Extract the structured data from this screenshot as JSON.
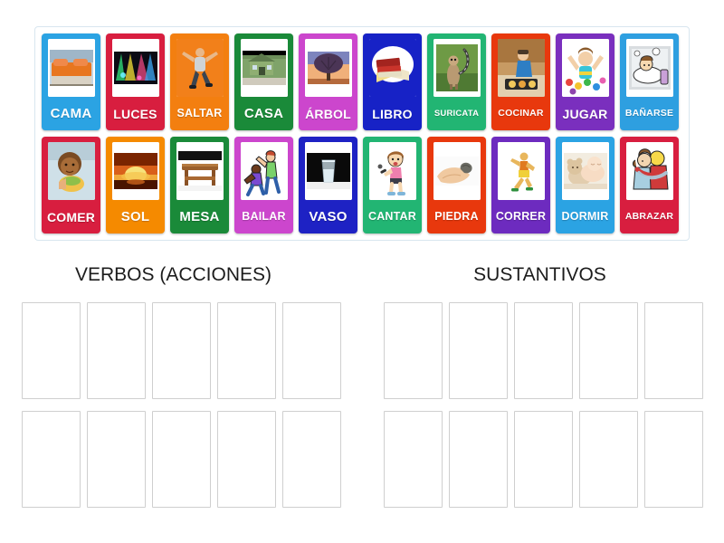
{
  "activity": {
    "type": "group-sort",
    "tray_rows": 2,
    "cards_per_row": 10
  },
  "tray": {
    "row1": [
      {
        "label": "CAMA",
        "color": "#2ba3e3",
        "image": "bed-photo",
        "category": "sustantivo"
      },
      {
        "label": "LUCES",
        "color": "#d81e3f",
        "image": "stage-lights-photo",
        "category": "sustantivo"
      },
      {
        "label": "SALTAR",
        "color": "#f37f10",
        "image": "jumping-man-photo",
        "category": "verbo"
      },
      {
        "label": "CASA",
        "color": "#1a8a39",
        "image": "house-photo",
        "category": "sustantivo"
      },
      {
        "label": "ÁRBOL",
        "color": "#cc46cd",
        "image": "tree-photo",
        "category": "sustantivo"
      },
      {
        "label": "LIBRO",
        "color": "#1722c6",
        "image": "books-illustration",
        "category": "sustantivo"
      },
      {
        "label": "SURICATA",
        "color": "#22b573",
        "image": "meerkat-photo",
        "category": "sustantivo"
      },
      {
        "label": "COCINAR",
        "color": "#e8380d",
        "image": "cooking-photo",
        "category": "verbo"
      },
      {
        "label": "JUGAR",
        "color": "#7a2fbe",
        "image": "child-playing-photo",
        "category": "verbo"
      },
      {
        "label": "BAÑARSE",
        "color": "#2e9fe0",
        "image": "bathing-illustration",
        "category": "verbo"
      }
    ],
    "row2": [
      {
        "label": "COMER",
        "color": "#d81e3f",
        "image": "child-eating-photo",
        "category": "verbo"
      },
      {
        "label": "SOL",
        "color": "#f58a00",
        "image": "sunset-photo",
        "category": "sustantivo"
      },
      {
        "label": "MESA",
        "color": "#1a8a39",
        "image": "table-photo",
        "category": "sustantivo"
      },
      {
        "label": "BAILAR",
        "color": "#cc46cd",
        "image": "dancing-illustration",
        "category": "verbo"
      },
      {
        "label": "VASO",
        "color": "#1e22c4",
        "image": "glass-photo",
        "category": "sustantivo"
      },
      {
        "label": "CANTAR",
        "color": "#22b573",
        "image": "singing-girl-illustration",
        "category": "verbo"
      },
      {
        "label": "PIEDRA",
        "color": "#e8380d",
        "image": "stone-in-hand-photo",
        "category": "sustantivo"
      },
      {
        "label": "CORRER",
        "color": "#6d2bbf",
        "image": "running-illustration",
        "category": "verbo"
      },
      {
        "label": "DORMIR",
        "color": "#2ba3e3",
        "image": "sleeping-baby-photo",
        "category": "verbo"
      },
      {
        "label": "ABRAZAR",
        "color": "#d81e3f",
        "image": "hugging-illustration",
        "category": "verbo"
      }
    ]
  },
  "categories": [
    {
      "title": "VERBOS (ACCIONES)",
      "slot_rows": 2,
      "slots_per_row": 5
    },
    {
      "title": "SUSTANTIVOS",
      "slot_rows": 2,
      "slots_per_row": 5
    }
  ],
  "colors": {
    "page_background": "#ffffff",
    "tray_border": "#d8e6ef",
    "slot_border": "#cfcfcf",
    "heading_text": "#1c1c1c",
    "card_label_text": "#ffffff"
  }
}
